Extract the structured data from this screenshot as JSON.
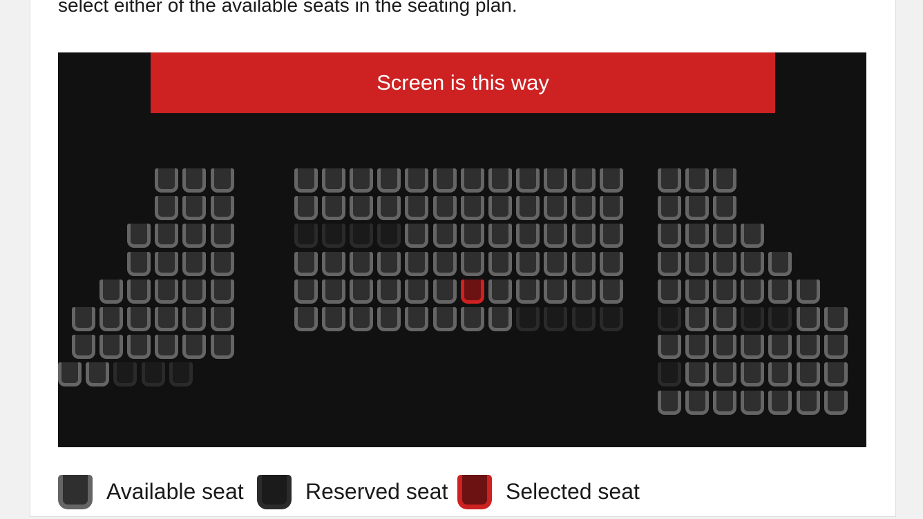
{
  "instruction": "select either of the available seats in the seating plan.",
  "screen_label": "Screen is this way",
  "legend": {
    "available": "Available seat",
    "reserved": "Reserved seat",
    "selected": "Selected seat"
  },
  "colors": {
    "available_border": "#656565",
    "available_fill": "#2f2f2f",
    "reserved_border": "#2a2a2a",
    "reserved_fill": "#1a1a1a",
    "selected_border": "#cd2122",
    "selected_fill": "#6d1213",
    "screen": "#cd2122",
    "plan_background": "#111111"
  },
  "seating": {
    "left_section": [
      "...AAA",
      "...AAA",
      "..AAAA",
      "..AAAA",
      ".AAAAA",
      "AAAAAA",
      "AAAAAA"
    ],
    "left_last_row": "AARRR",
    "center_section": [
      "AAAAAAAAAAAA",
      "AAAAAAAAAAAA",
      "RRRRAAAAAAAA",
      "AAAAAAAAAAAA",
      "AAAAAASAAAAA",
      "AAAAAAAARRRR"
    ],
    "right_section": [
      "AAA",
      "AAA",
      "AAAA",
      "AAAAA",
      "AAAAAA",
      "RAARRAA",
      "AAAAAAA",
      "RAAAAAA",
      "AAAAAAA"
    ]
  }
}
